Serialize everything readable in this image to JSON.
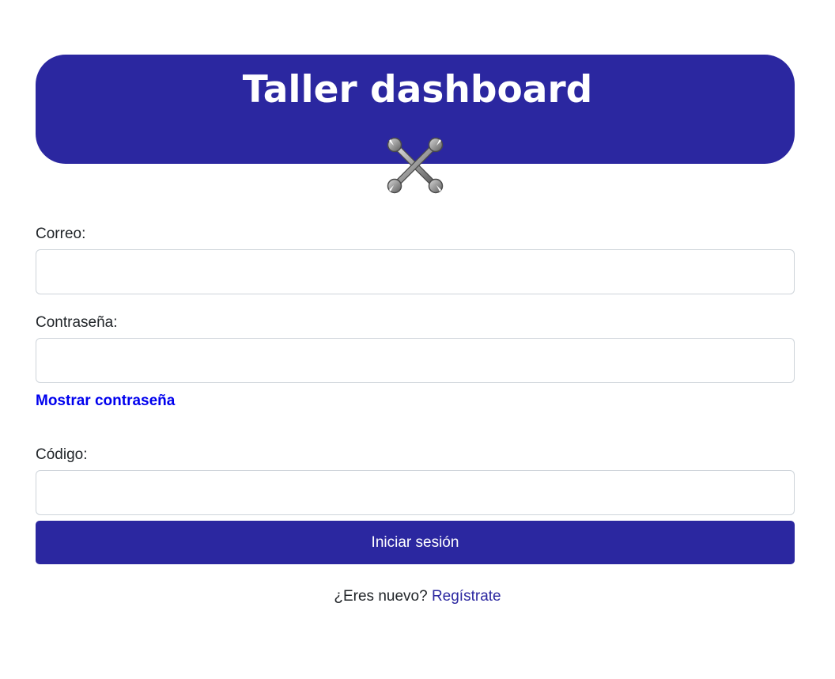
{
  "header": {
    "title": "Taller dashboard",
    "icon": "crossed-wrenches-icon",
    "background_color": "#2b27a0"
  },
  "form": {
    "email": {
      "label": "Correo:",
      "value": "",
      "placeholder": ""
    },
    "password": {
      "label": "Contraseña:",
      "value": "",
      "placeholder": ""
    },
    "show_password_label": "Mostrar contraseña",
    "code": {
      "label": "Código:",
      "value": "",
      "placeholder": ""
    },
    "submit_label": "Iniciar sesión"
  },
  "footer": {
    "prompt": "¿Eres nuevo?",
    "register_label": "Regístrate"
  },
  "colors": {
    "primary": "#2b27a0",
    "link": "#0000ee",
    "input_border": "#ced4da"
  }
}
